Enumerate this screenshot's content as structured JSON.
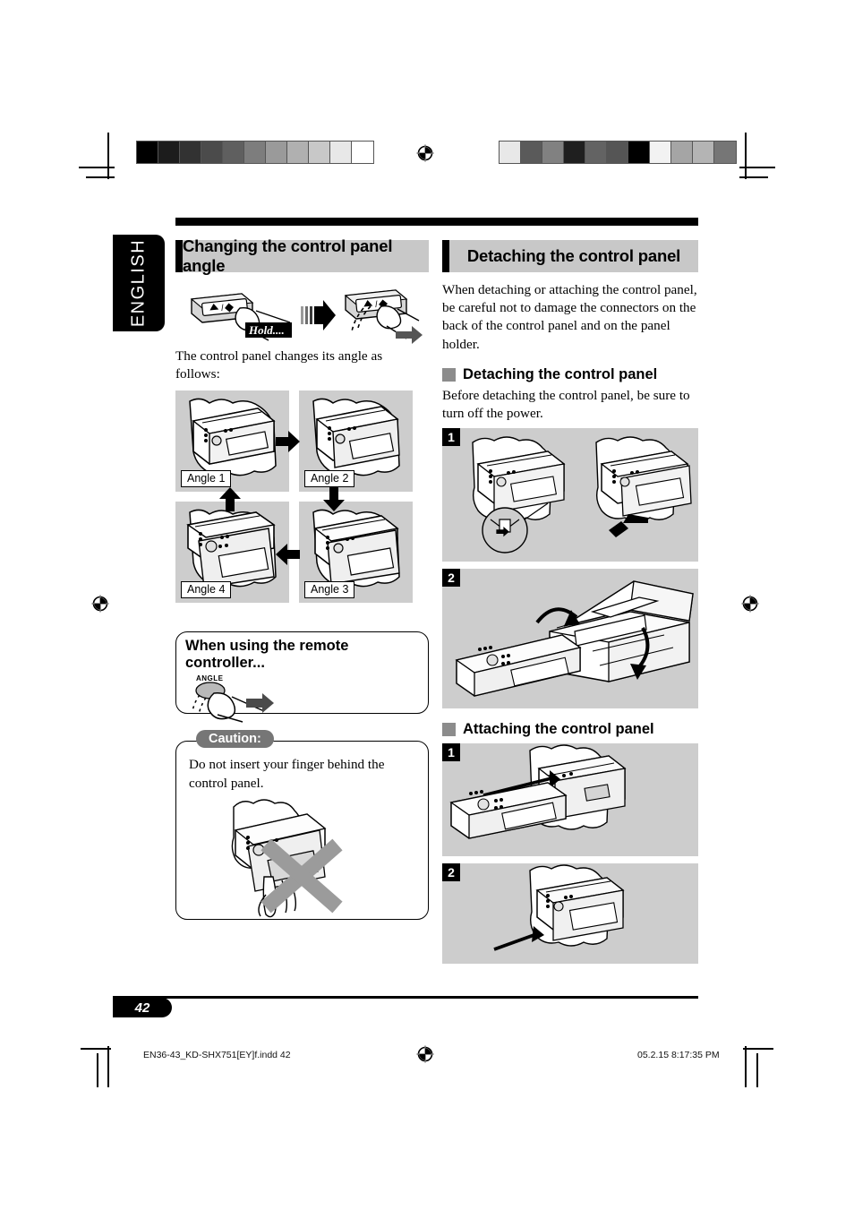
{
  "document": {
    "language_tab": "ENGLISH",
    "page_number": "42",
    "footer_file": "EN36-43_KD-SHX751[EY]f.indd   42",
    "footer_timestamp": "05.2.15   8:17:35 PM"
  },
  "colors": {
    "panel_gray": "#cdcdcd",
    "header_gray": "#c8c8c8",
    "bullet_gray": "#8c8c8c",
    "caution_gray": "#767676",
    "black": "#000000",
    "white": "#ffffff"
  },
  "prepress": {
    "left_bar_steps": [
      "#000000",
      "#1c1c1c",
      "#323232",
      "#4b4b4b",
      "#5f5f5f",
      "#7d7d7d",
      "#9a9a9a",
      "#b0b0b0",
      "#c8c8c8",
      "#e8e8e8",
      "#ffffff"
    ],
    "right_bar_steps": [
      "#e8e8e8",
      "#5a5a5a",
      "#818181",
      "#1f1f1f",
      "#636363",
      "#555555",
      "#000000",
      "#f2f2f2",
      "#a5a5a5",
      "#b4b4b4",
      "#767676"
    ]
  },
  "left_column": {
    "section_title": "Changing the control panel angle",
    "hold_label": "Hold....",
    "button_symbols": "▲/⬍",
    "intro_text": "The control panel changes its angle as follows:",
    "angles": [
      {
        "label": "Angle 1"
      },
      {
        "label": "Angle 2"
      },
      {
        "label": "Angle 4"
      },
      {
        "label": "Angle 3"
      }
    ],
    "remote_box": {
      "title": "When using the remote controller...",
      "button_label": "ANGLE"
    },
    "caution_box": {
      "tag": "Caution:",
      "text": "Do not insert your finger behind the control panel."
    }
  },
  "right_column": {
    "section_title": "Detaching the control panel",
    "intro_text": "When detaching or attaching the control panel, be careful not to damage the connectors on the back of the control panel and on the panel holder.",
    "detach": {
      "sub_title": "Detaching the control panel",
      "note": "Before detaching the control panel, be sure to turn off the power.",
      "steps": [
        "1",
        "2"
      ]
    },
    "attach": {
      "sub_title": "Attaching the control panel",
      "steps": [
        "1",
        "2"
      ]
    }
  }
}
